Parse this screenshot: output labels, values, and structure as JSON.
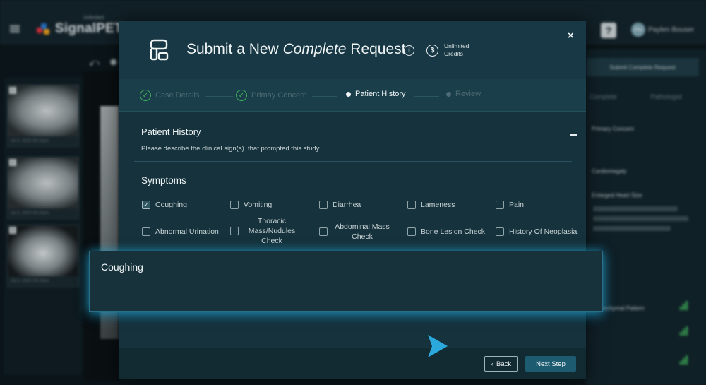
{
  "app": {
    "logo_text": "SignalPET",
    "logo_sub": "Unlimited",
    "help_label": "?",
    "user_initials": "PH",
    "user_name": "Paylen Bouser"
  },
  "background": {
    "toolbar_icons": [
      "undo-icon",
      "brightness-icon"
    ],
    "thumbnails": [
      {
        "num": "1",
        "date": "Jul 2, 2025 08:15am"
      },
      {
        "num": "2",
        "date": "Jul 2, 2025 08:15am"
      },
      {
        "num": "3",
        "date": "Jul 2, 2025 08:15am"
      }
    ],
    "right_button": "Submit Complete Request",
    "right_tabs": [
      "Complete",
      "Pathologist"
    ],
    "right_sections": [
      "Primary Concern",
      "Cardiomegaly",
      "Enlarged Heart Size",
      "Parenchymal Pattern"
    ]
  },
  "modal": {
    "title_pre": "Submit a New ",
    "title_italic": "Complete",
    "title_post": " Request",
    "credits_line1": "Unlimited",
    "credits_line2": "Credits",
    "close_label": "×",
    "steps": [
      {
        "label": "Case Details",
        "status": "done"
      },
      {
        "label": "Primay Concern",
        "status": "done"
      },
      {
        "label": "Patient History",
        "status": "active"
      },
      {
        "label": "Review",
        "status": "pending"
      }
    ],
    "section_title": "Patient History",
    "section_desc": "Please describe the clinical sign(s)  that prompted this study.",
    "symptoms_title": "Symptoms",
    "symptoms": [
      {
        "label": "Coughing",
        "checked": true
      },
      {
        "label": "Vomiting",
        "checked": false
      },
      {
        "label": "Diarrhea",
        "checked": false
      },
      {
        "label": "Lameness",
        "checked": false
      },
      {
        "label": "Pain",
        "checked": false
      },
      {
        "label": "Abnormal Urination",
        "checked": false
      },
      {
        "label": "Thoracic Mass/Nudules Check",
        "checked": false
      },
      {
        "label": "Abdominal Mass Check",
        "checked": false
      },
      {
        "label": "Bone Lesion Check",
        "checked": false
      },
      {
        "label": "History Of Neoplasia",
        "checked": false
      }
    ],
    "back_label": "Back",
    "next_label": "Next Step"
  },
  "callout": {
    "text": "Coughing"
  },
  "colors": {
    "accent": "#1d5c70",
    "success": "#3fae5a",
    "glow": "#28aad7",
    "cursor": "#2ba8dc"
  }
}
